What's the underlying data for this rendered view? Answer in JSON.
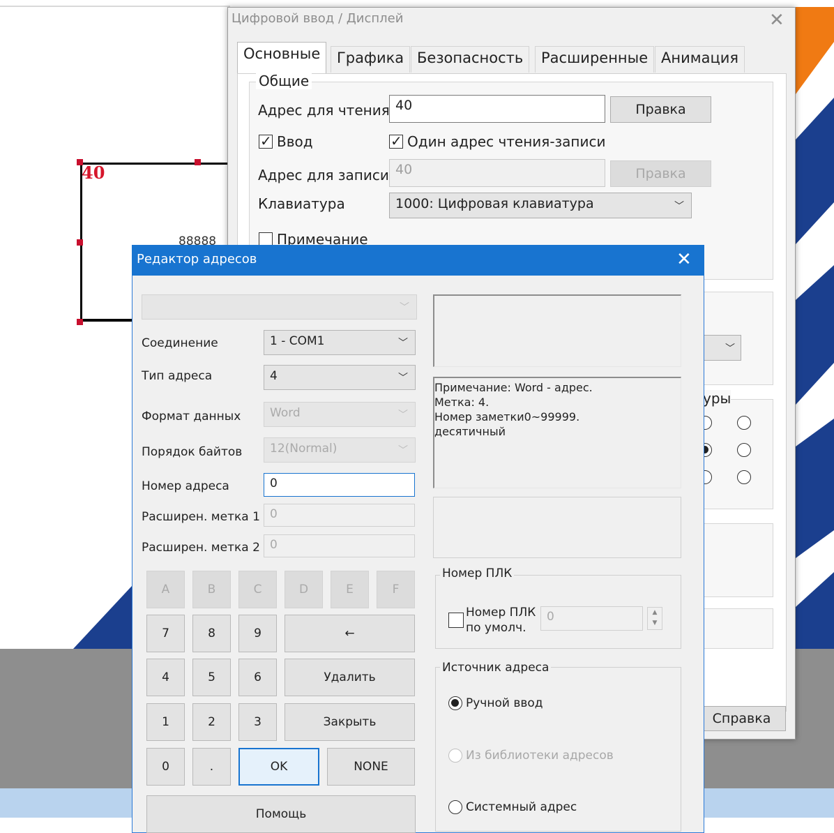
{
  "property_dialog": {
    "title": "Цифровой ввод / Дисплей",
    "tabs": [
      "Основные",
      "Графика",
      "Безопасность",
      "Расширенные",
      "Анимация"
    ],
    "general_group": "Общие",
    "read_address_label": "Адрес для чтения",
    "read_address_value": "40",
    "edit_label": "Правка",
    "input_checkbox": "Ввод",
    "same_address_checkbox": "Один адрес чтения-записи",
    "write_address_label": "Адрес для записи",
    "write_address_value": "40",
    "keyboard_label": "Клавиатура",
    "keyboard_value": "1000: Цифровая клавиатура",
    "note_checkbox": "Примечание",
    "partial_group_label": "уры",
    "help_button": "Справка"
  },
  "canvas": {
    "object_label": "40",
    "display_placeholder": "88888"
  },
  "address_editor": {
    "title": "Редактор адресов",
    "device_select": "",
    "connection_label": "Соединение",
    "connection_value": "1 - COM1",
    "address_type_label": "Тип адреса",
    "address_type_value": "4",
    "data_format_label": "Формат данных",
    "data_format_value": "Word",
    "byte_order_label": "Порядок байтов",
    "byte_order_value": "12(Normal)",
    "address_number_label": "Номер адреса",
    "address_number_value": "0",
    "ext_tag1_label": "Расширен. метка 1",
    "ext_tag1_value": "0",
    "ext_tag2_label": "Расширен. метка 2",
    "ext_tag2_value": "0",
    "hex_keys": [
      "A",
      "B",
      "C",
      "D",
      "E",
      "F"
    ],
    "keys": {
      "k7": "7",
      "k8": "8",
      "k9": "9",
      "backspace": "←",
      "k4": "4",
      "k5": "5",
      "k6": "6",
      "delete": "Удалить",
      "k1": "1",
      "k2": "2",
      "k3": "3",
      "close": "Закрыть",
      "k0": "0",
      "dot": ".",
      "ok": "OK",
      "none": "NONE",
      "help": "Помощь"
    },
    "note_text": "Примечание: Word - адрес.\nМетка: 4.\nНомер заметки0~99999.\nдесятичный",
    "plc_group": "Номер ПЛК",
    "plc_default_checkbox_line1": "Номер ПЛК",
    "plc_default_checkbox_line2": "по умолч.",
    "plc_value": "0",
    "source_group": "Источник адреса",
    "source_manual": "Ручной ввод",
    "source_library": "Из библиотеки адресов",
    "source_system": "Системный адрес"
  },
  "colors": {
    "editor_title_bar": "#1874d0",
    "canvas_label_red": "#d6162b",
    "orange_decor": "#f07a13",
    "navy_decor": "#1b3f8e"
  }
}
